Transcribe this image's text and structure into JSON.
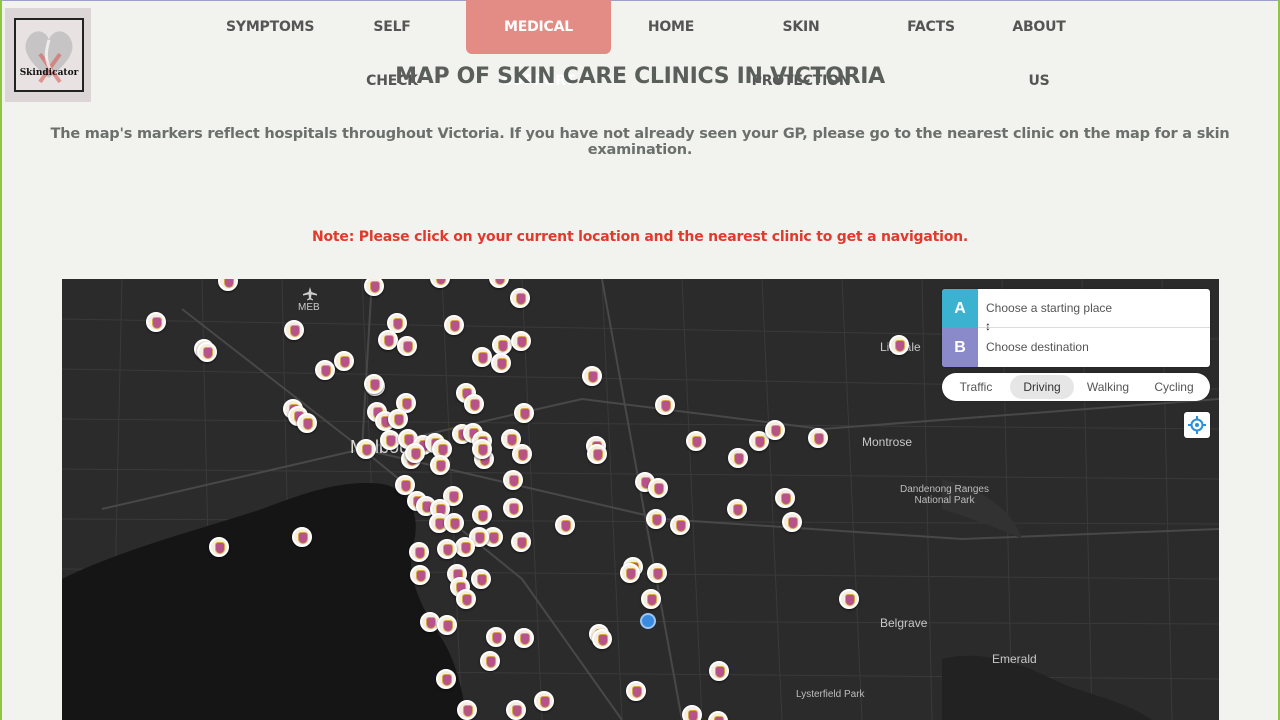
{
  "brand": {
    "name": "Skindicator"
  },
  "nav": {
    "items": [
      {
        "label": "SYMPTOMS"
      },
      {
        "label": "SELF CHECK"
      },
      {
        "label": "MEDICAL SUPPORT",
        "active": true
      },
      {
        "label": "HOME"
      },
      {
        "label": "SKIN PROTECTION"
      },
      {
        "label": "FACTS"
      },
      {
        "label": "ABOUT US"
      }
    ]
  },
  "page": {
    "title": "MAP OF SKIN CARE CLINICS IN VICTORIA",
    "intro": "The map's markers reflect hospitals throughout Victoria. If you have not already seen your GP, please go to the nearest clinic on the map for a skin examination.",
    "note": "Note: Please click on your current location and the nearest clinic to get a navigation."
  },
  "map": {
    "labels": {
      "airport": "MEB",
      "melbourne": "Melbourne",
      "lilydale": "Lilydale",
      "montrose": "Montrose",
      "dandenong": "Dandenong Ranges\nNational Park",
      "belgrave": "Belgrave",
      "emerald": "Emerald",
      "lysterfield": "Lysterfield Park"
    },
    "directions": {
      "origin_tag": "A",
      "destination_tag": "B",
      "origin_placeholder": "Choose a starting place",
      "destination_placeholder": "Choose destination",
      "profiles": [
        "Traffic",
        "Driving",
        "Walking",
        "Cycling"
      ],
      "active_profile": "Driving"
    }
  },
  "colors": {
    "accent": "#e38b85",
    "note": "#e03a2c",
    "map_bg": "#2b2b2b",
    "origin": "#3bb2d0",
    "destination": "#8a8acb"
  }
}
